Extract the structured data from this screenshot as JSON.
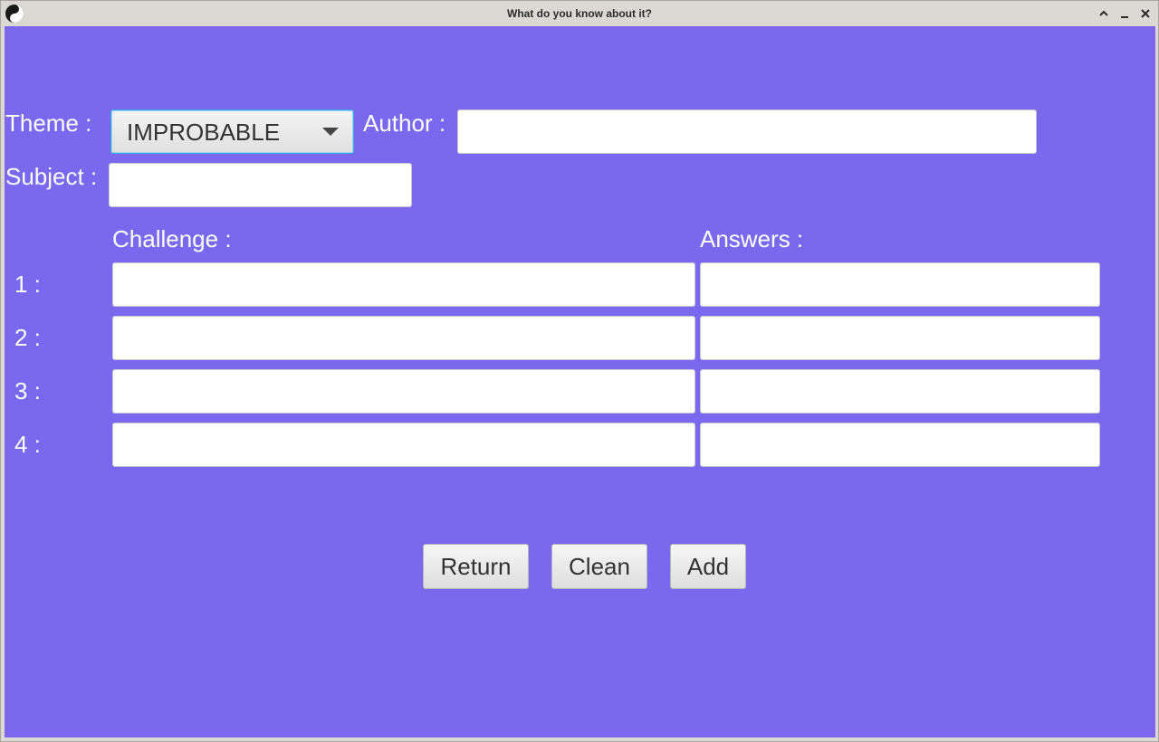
{
  "window": {
    "title": "What do you know about it?",
    "icons": {
      "app": "yin-yang-icon",
      "maximize": "chevron-up-icon",
      "minimize": "minimize-icon",
      "close": "close-icon"
    }
  },
  "colors": {
    "background": "#7b68ee",
    "label_text": "#ffffff",
    "titlebar": "#dcd9d5",
    "combo_focus": "#3aa9e0"
  },
  "form": {
    "theme_label": "Theme :",
    "theme_selected": "IMPROBABLE",
    "author_label": "Author :",
    "author_value": "",
    "subject_label": "Subject :",
    "subject_value": ""
  },
  "questions": {
    "challenge_header": "Challenge :",
    "answers_header": "Answers :",
    "rows": [
      {
        "label": "1 :",
        "challenge": "",
        "answer": ""
      },
      {
        "label": "2 :",
        "challenge": "",
        "answer": ""
      },
      {
        "label": "3 :",
        "challenge": "",
        "answer": ""
      },
      {
        "label": "4 :",
        "challenge": "",
        "answer": ""
      }
    ]
  },
  "buttons": {
    "return_label": "Return",
    "clean_label": "Clean",
    "add_label": "Add"
  }
}
